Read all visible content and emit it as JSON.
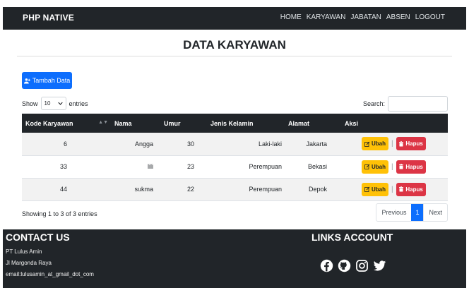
{
  "navbar": {
    "brand": "PHP NATIVE",
    "links": [
      "HOME",
      "KARYAWAN",
      "JABATAN",
      "ABSEN",
      "LOGOUT"
    ]
  },
  "page": {
    "title": "DATA KARYAWAN",
    "add_button": "Tambah Data"
  },
  "controls": {
    "show_label": "Show",
    "entries_label": "entries",
    "length_value": "10",
    "search_label": "Search:",
    "search_value": ""
  },
  "table": {
    "headers": [
      "Kode Karyawan",
      "Nama",
      "Umur",
      "Jenis Kelamin",
      "Alamat",
      "Aksi"
    ],
    "rows": [
      {
        "kode": "6",
        "nama": "Angga",
        "umur": "30",
        "jenis_kelamin": "Laki-laki",
        "alamat": "Jakarta"
      },
      {
        "kode": "33",
        "nama": "lili",
        "umur": "23",
        "jenis_kelamin": "Perempuan",
        "alamat": "Bekasi"
      },
      {
        "kode": "44",
        "nama": "sukma",
        "umur": "22",
        "jenis_kelamin": "Perempuan",
        "alamat": "Depok"
      }
    ],
    "ubah_label": "Ubah",
    "hapus_label": "Hapus",
    "separator": "|"
  },
  "info": "Showing 1 to 3 of 3 entries",
  "pagination": {
    "previous": "Previous",
    "current": "1",
    "next": "Next"
  },
  "footer": {
    "contact_title": "CONTACT US",
    "contact_lines": [
      "PT Lulus Amin",
      "Jl Margonda Raya",
      "email:lulusamin_at_gmail_dot_com"
    ],
    "links_title": "LINKS ACCOUNT",
    "social_icons": [
      "facebook-icon",
      "github-icon",
      "instagram-icon",
      "twitter-icon"
    ]
  },
  "colors": {
    "dark": "#212529",
    "primary": "#0d6efd",
    "warning": "#ffc107",
    "danger": "#dc3545"
  }
}
